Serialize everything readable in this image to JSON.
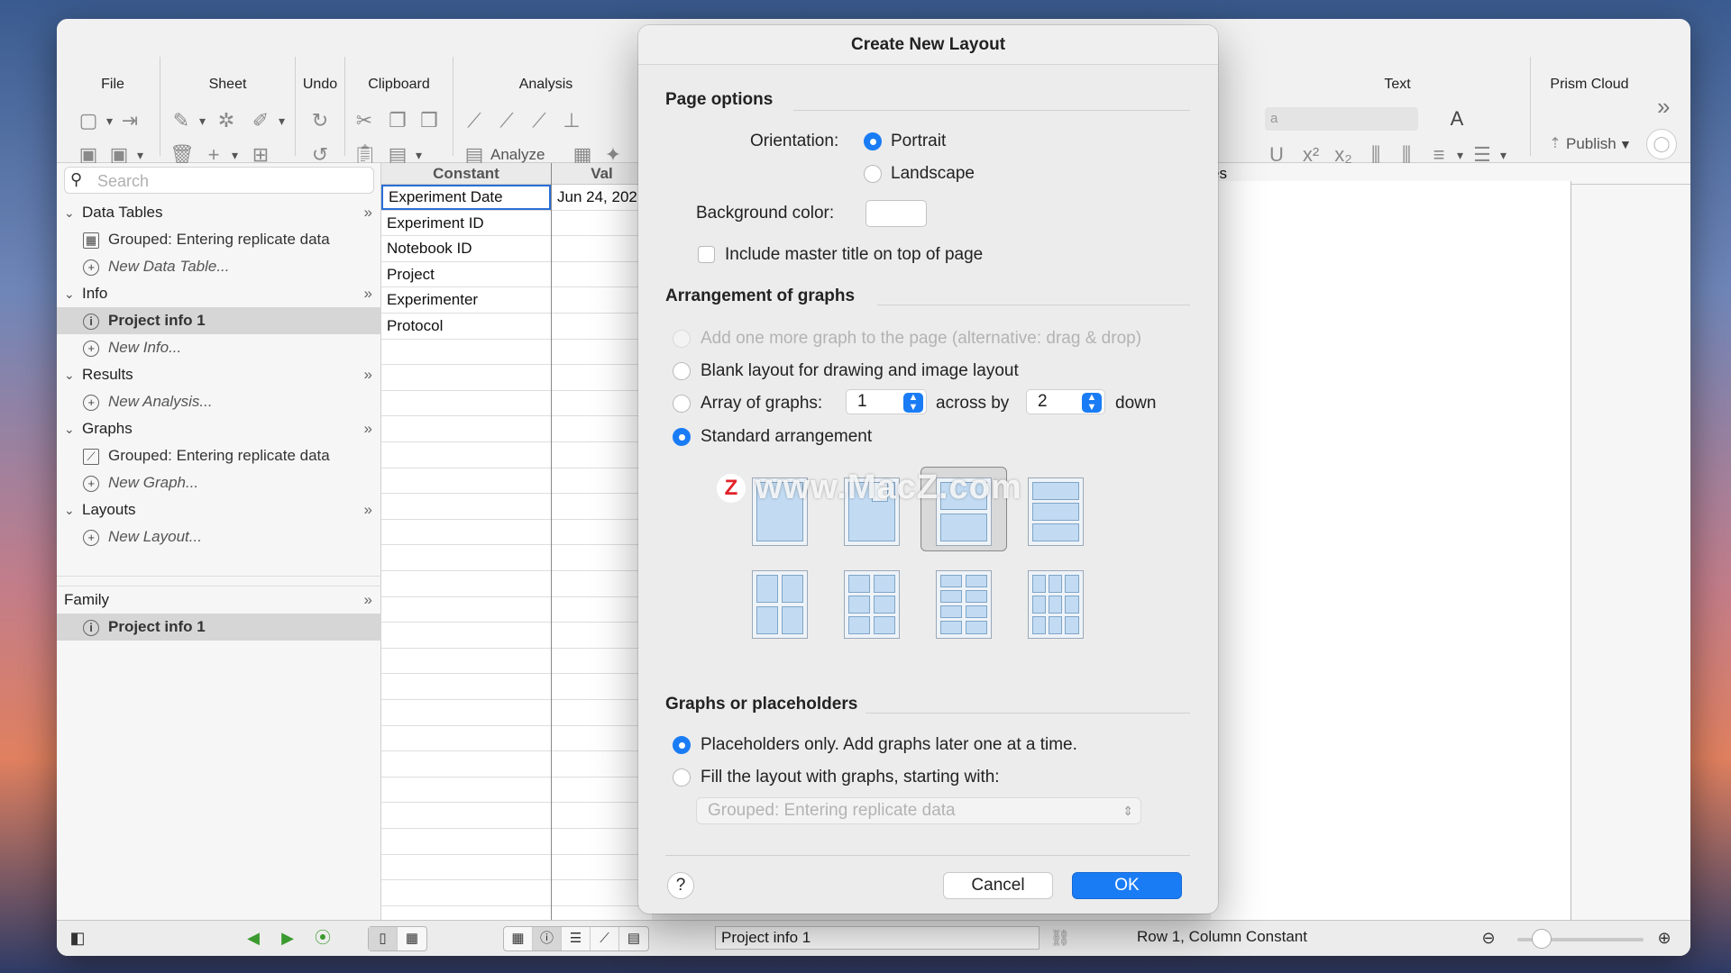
{
  "toolbar": {
    "groups": [
      "File",
      "Sheet",
      "Undo",
      "Clipboard",
      "Analysis",
      "Text",
      "Prism Cloud"
    ],
    "analyze_label": "Analyze",
    "publish_label": "Publish",
    "font_field_value": "a"
  },
  "sidebar": {
    "search_placeholder": "Search",
    "sections": {
      "data_tables": "Data Tables",
      "data_table_item": "Grouped: Entering replicate data",
      "data_table_new": "New Data Table...",
      "info": "Info",
      "info_item": "Project info 1",
      "info_new": "New Info...",
      "results": "Results",
      "results_new": "New Analysis...",
      "graphs": "Graphs",
      "graph_item": "Grouped: Entering replicate data",
      "graph_new": "New Graph...",
      "layouts": "Layouts",
      "layouts_new": "New Layout..."
    },
    "family_label": "Family",
    "family_item": "Project info 1"
  },
  "sheet": {
    "col1_header": "Constant",
    "col2_header": "Val",
    "rows": [
      "Experiment Date",
      "Experiment ID",
      "Notebook ID",
      "Project",
      "Experimenter",
      "Protocol"
    ],
    "first_value": "Jun 24, 202",
    "right_header_fragment": "es"
  },
  "statusbar": {
    "sheet_name": "Project info 1",
    "position": "Row 1, Column Constant"
  },
  "dialog": {
    "title": "Create New Layout",
    "page_options": "Page options",
    "orientation_label": "Orientation:",
    "portrait": "Portrait",
    "landscape": "Landscape",
    "background_color_label": "Background color:",
    "include_master_title": "Include master title on top of page",
    "arrangement_title": "Arrangement of graphs",
    "opt_add_one": "Add one more graph to the page (alternative: drag & drop)",
    "opt_blank": "Blank layout for drawing and image layout",
    "opt_array": "Array of graphs:",
    "array_across": "1",
    "across_by": "across by",
    "array_down": "2",
    "down": "down",
    "opt_standard": "Standard arrangement",
    "graphs_or_placeholders": "Graphs or placeholders",
    "opt_placeholders": "Placeholders only. Add graphs later one at a time.",
    "opt_fill": "Fill the layout with graphs, starting with:",
    "fill_select_value": "Grouped: Entering replicate data",
    "help": "?",
    "cancel": "Cancel",
    "ok": "OK"
  },
  "watermark": {
    "text": "www.MacZ.com",
    "badge": "Z"
  },
  "colors": {
    "accent": "#1a7cf5",
    "selected_row": "#d6d6d6"
  }
}
